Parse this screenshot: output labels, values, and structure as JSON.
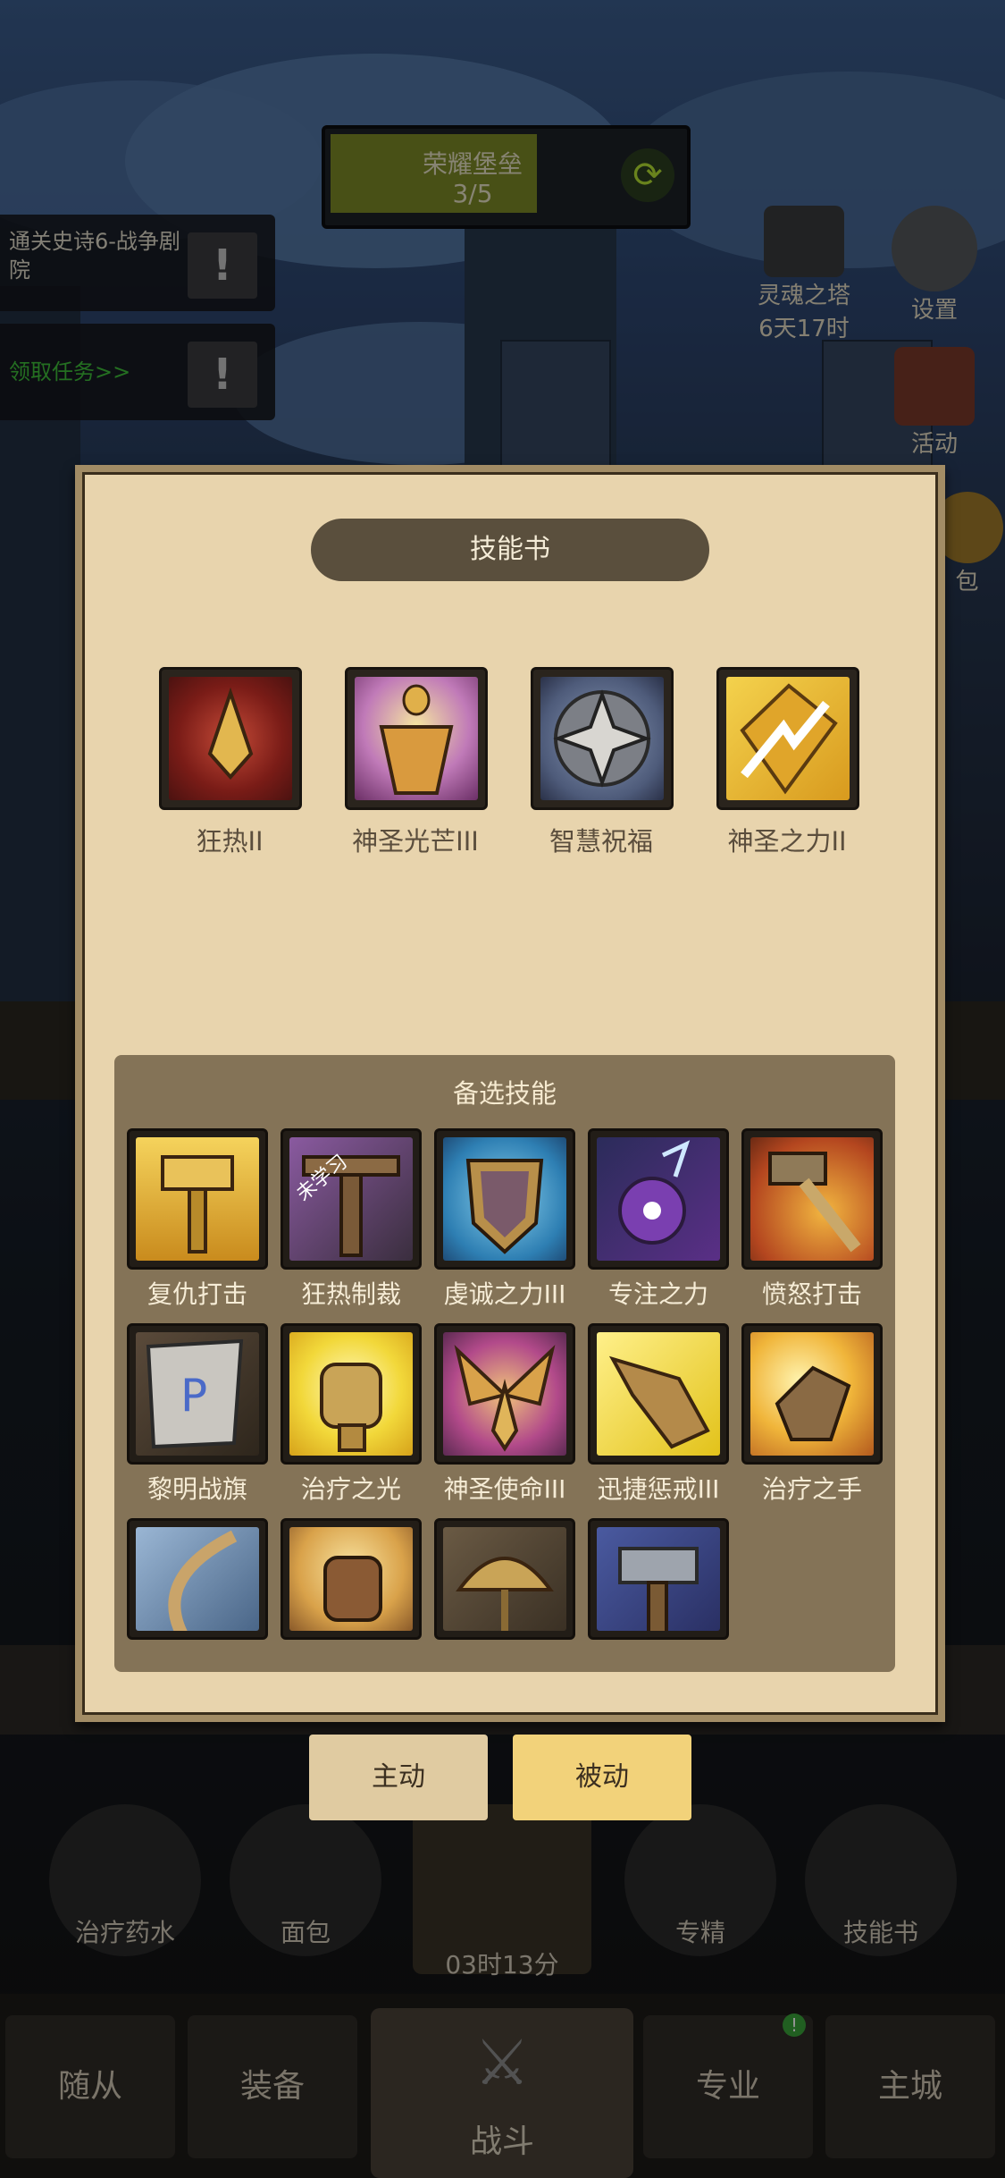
{
  "hud": {
    "glory_title": "荣耀堡垒",
    "glory_progress_text": "3/5",
    "glory_progress": 0.6,
    "quest1": "通关史诗6-战争剧院",
    "quest2": "领取任务>>",
    "soul_tower_title": "灵魂之塔",
    "soul_tower_time": "6天17时",
    "settings_label": "设置",
    "activity_label": "活动",
    "bag_label": "包"
  },
  "modal": {
    "title": "技能书",
    "equipped": [
      {
        "label": "狂热II",
        "icon": "zeal-flame-icon"
      },
      {
        "label": "神圣光芒III",
        "icon": "holy-radiance-icon"
      },
      {
        "label": "智慧祝福",
        "icon": "wisdom-blessing-icon"
      },
      {
        "label": "神圣之力II",
        "icon": "holy-might-icon"
      }
    ],
    "pool_title": "备选技能",
    "pool": [
      {
        "label": "复仇打击",
        "icon": "vengeance-hammer-icon"
      },
      {
        "label": "狂热制裁",
        "icon": "zeal-judgement-icon",
        "badge": "未学习"
      },
      {
        "label": "虔诚之力III",
        "icon": "devotion-shield-icon"
      },
      {
        "label": "专注之力",
        "icon": "focus-orb-icon"
      },
      {
        "label": "愤怒打击",
        "icon": "wrath-hammer-icon"
      },
      {
        "label": "黎明战旗",
        "icon": "dawn-banner-icon"
      },
      {
        "label": "治疗之光",
        "icon": "healing-light-fist-icon"
      },
      {
        "label": "神圣使命III",
        "icon": "sacred-mission-wings-icon"
      },
      {
        "label": "迅捷惩戒III",
        "icon": "swift-chastise-hand-icon"
      },
      {
        "label": "治疗之手",
        "icon": "healing-hand-icon"
      },
      {
        "label": "",
        "icon": "bow-icon"
      },
      {
        "label": "",
        "icon": "fist-icon"
      },
      {
        "label": "",
        "icon": "umbrella-shield-icon"
      },
      {
        "label": "",
        "icon": "war-hammer-icon"
      }
    ]
  },
  "tabs": {
    "active": "主动",
    "passive": "被动"
  },
  "shelf": {
    "potion": "治疗药水",
    "bread": "面包",
    "chest_timer": "03时13分",
    "specialize": "专精",
    "skillbook": "技能书"
  },
  "nav": {
    "followers": "随从",
    "equipment": "装备",
    "battle": "战斗",
    "profession": "专业",
    "main_city": "主城"
  },
  "colors": {
    "modal_bg": "#e8d4ad",
    "pool_bg": "#847357",
    "passive_tab": "#f2d27a",
    "progress_fill": "#7d8a26"
  }
}
